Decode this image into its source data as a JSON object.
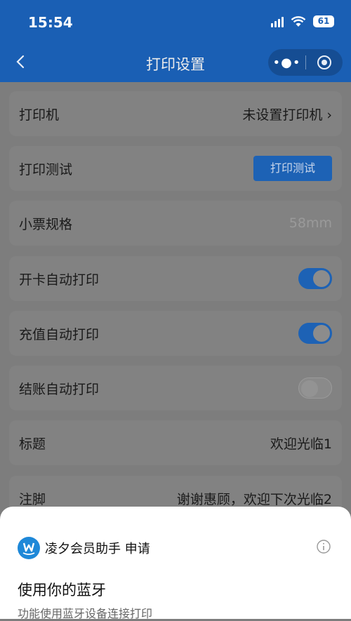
{
  "status": {
    "time": "15:54",
    "battery": "61"
  },
  "nav": {
    "title": "打印设置"
  },
  "settings": {
    "printer": {
      "label": "打印机",
      "value": "未设置打印机 ›"
    },
    "print_test": {
      "label": "打印测试",
      "button": "打印测试"
    },
    "receipt_size": {
      "label": "小票规格",
      "value": "58mm"
    },
    "auto_print_card": {
      "label": "开卡自动打印",
      "enabled": true
    },
    "auto_print_recharge": {
      "label": "充值自动打印",
      "enabled": true
    },
    "auto_print_checkout": {
      "label": "结账自动打印",
      "enabled": false
    },
    "title": {
      "label": "标题",
      "value": "欢迎光临1"
    },
    "footer": {
      "label": "注脚",
      "value": "谢谢惠顾，欢迎下次光临2"
    }
  },
  "sheet": {
    "app_request": "凌夕会员助手 申请",
    "permission_title": "使用你的蓝牙",
    "permission_desc": "功能使用蓝牙设备连接打印"
  },
  "colors": {
    "primary": "#1a5fb4",
    "toggle_on": "#1d62b5"
  }
}
